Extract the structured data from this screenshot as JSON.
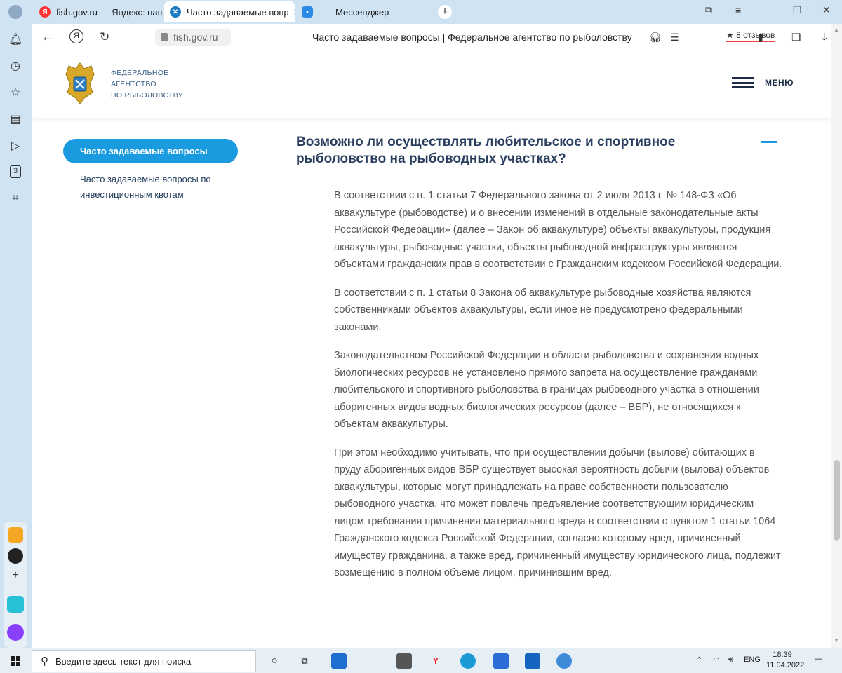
{
  "browser": {
    "tabs": [
      {
        "label": "fish.gov.ru — Яндекс: наш",
        "icon": "yandex-icon"
      },
      {
        "label": "Часто задаваемые вопр",
        "icon": "fish-gov-icon"
      },
      {
        "label": "Мессенджер",
        "icon": "messenger-icon"
      }
    ],
    "url": "fish.gov.ru",
    "page_title": "Часто задаваемые вопросы | Федеральное агентство по рыболовству",
    "reviews": "8 отзывов"
  },
  "site": {
    "logo_lines": [
      "ФЕДЕРАЛЬНОЕ",
      "АГЕНТСТВО",
      "ПО РЫБОЛОВСТВУ"
    ],
    "menu_label": "МЕНЮ"
  },
  "sidebar": {
    "active": "Часто задаваемые вопросы",
    "link": "Часто задаваемые вопросы по инвестиционным квотам"
  },
  "question": {
    "title": "Возможно ли осуществлять любительское и спортивное рыболовство на рыбоводных участках?",
    "paragraphs": [
      "В соответствии с п. 1 статьи 7 Федерального закона от 2 июля 2013 г. № 148-ФЗ «Об аквакультуре (рыбоводстве) и о внесении изменений в отдельные законодательные акты Российской Федерации» (далее – Закон об аквакультуре) объекты аквакультуры, продукция аквакультуры, рыбоводные участки, объекты рыбоводной инфраструктуры являются объектами гражданских прав в соответствии с Гражданским кодексом Российской Федерации.",
      "В соответствии с п. 1 статьи 8 Закона об аквакультуре рыбоводные хозяйства являются собственниками объектов аквакультуры, если иное не предусмотрено федеральными законами.",
      "Законодательством Российской Федерации в области рыболовства и сохранения водных биологических ресурсов не установлено прямого запрета на осуществление гражданами любительского и спортивного рыболовства в границах рыбоводного участка в отношении аборигенных видов водных биологических ресурсов (далее – ВБР), не относящихся к объектам аквакультуры.",
      "При этом необходимо учитывать, что при осуществлении добычи (вылове) обитающих в пруду аборигенных видов ВБР существует высокая вероятность добычи (вылова) объектов аквакультуры, которые могут принадлежать на праве собственности пользователю рыбоводного участка, что может повлечь предъявление соответствующим юридическим лицом требования причинения материального вреда в соответствии с пунктом 1 статьи 1064 Гражданского кодекса Российской Федерации, согласно которому вред, причиненный имуществу гражданина, а также вред, причиненный имуществу юридического лица, подлежит возмещению в полном объеме лицом, причинившим вред."
    ]
  },
  "taskbar": {
    "search_placeholder": "Введите здесь текст для поиска",
    "lang": "ENG",
    "time": "18:39",
    "date": "11.04.2022"
  }
}
